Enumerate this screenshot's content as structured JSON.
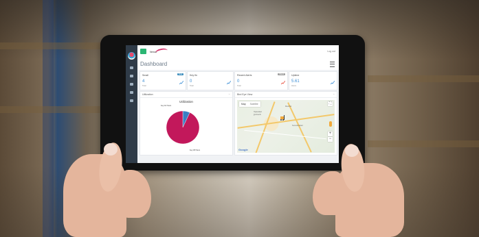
{
  "app": {
    "brand_text": "Nexus",
    "logout_label": "Log out",
    "page_title": "Dashboard"
  },
  "cards": [
    {
      "label": "Small",
      "badge": "Total",
      "badge_color": "#3c8dbc",
      "value": "4",
      "sub": "Total"
    },
    {
      "label": "Key fin",
      "badge": "",
      "badge_color": "",
      "value": "0",
      "sub": "Total"
    },
    {
      "label": "Recent Alerts",
      "badge": "Week",
      "badge_color": "#9e9e9e",
      "value": "0",
      "sub": "Total"
    },
    {
      "label": "Uptime",
      "badge": "",
      "badge_color": "",
      "value": "5.61",
      "sub": "Hours"
    }
  ],
  "panels": {
    "utilization": {
      "header": "Utilization",
      "collapse": "−"
    },
    "map": {
      "header": "Bird Eye View",
      "collapse": "−"
    }
  },
  "chart_data": {
    "type": "pie",
    "title": "Utilization",
    "categories": [
      "Key On Hours",
      "Key Off Hours"
    ],
    "values": [
      7,
      93
    ],
    "colors": [
      "#3a7fc4",
      "#c2185b"
    ]
  },
  "map": {
    "tabs": [
      "Map",
      "Satellite"
    ],
    "fullscreen": "⛶",
    "zoom_in": "+",
    "zoom_out": "−",
    "logo": "Google",
    "labels": [
      "Hyderabad",
      "హైదరాబాద్",
      "Secunderabad",
      "Medchal"
    ]
  },
  "icons": [
    "menu-icon",
    "filter-icon",
    "forklift-marker-icon",
    "pegman-icon"
  ]
}
